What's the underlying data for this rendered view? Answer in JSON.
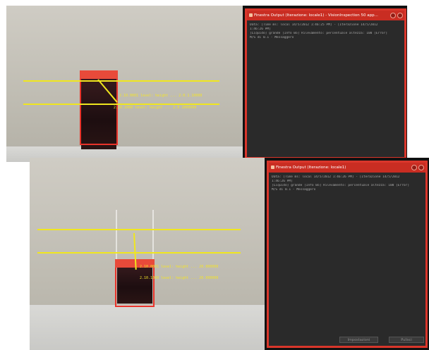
{
  "panels": [
    {
      "console": {
        "title": "Finestra Output (Iterazione: locale1) - VisionInspection 50 app...",
        "lines": [
          "Data: [Time ms: local 14/5/2012 1:46:25 PM] - [Iterazione 14/5/2012",
          "1:46:26 PM]",
          "[Liquido] grande [Info Bo] Rilevamento: percentuale altezza: 100 [Error]",
          "M/S di 0.1 - Messaggero"
        ]
      },
      "annotations": {
        "upper": "2.10.0001 level: height ... 2.0.1.10000",
        "lower": "2.10.1000 level: height ... 2.0.1000000"
      }
    },
    {
      "console": {
        "title": "Finestra Output (Iterazione: locale1)",
        "lines": [
          "Data: [Time ms: local 14/5/2012 1:46:26 PM] - [Iterazione 14/5/2012",
          "1:46:26 PM]",
          "[Liquido] grande [Info Bo] Rilevamento: percentuale altezza: 100 [Error]",
          "M/S di 0.1 - Messaggero"
        ],
        "footer": {
          "left_button": "Impostazioni",
          "right_button": "Pulisci"
        }
      },
      "annotations": {
        "upper": "2.10.0001 level: height ... 20.000000",
        "lower": "2.10.1000 level: height ... 20.000000"
      }
    }
  ],
  "colors": {
    "detection_red": "#e8332a",
    "level_line_yellow": "#f0e61e",
    "console_bg": "#2a2a2a",
    "console_border": "#d9362b"
  }
}
